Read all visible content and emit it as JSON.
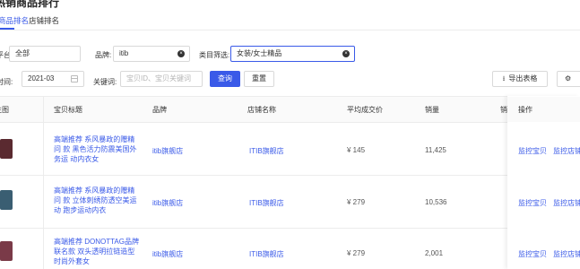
{
  "page": {
    "title": "热销商品排行"
  },
  "tabs": [
    {
      "label": "商品排名"
    },
    {
      "label": "店铺排名"
    }
  ],
  "filters": {
    "platform_label": "平台:",
    "platform_value": "全部",
    "brand_label": "品牌:",
    "brand_value": "itib",
    "category_label": "类目筛选:",
    "category_value": "女装/女士精品",
    "time_label": "时间:",
    "time_value": "2021-03",
    "keyword_label": "关键词:",
    "keyword_placeholder": "宝贝ID、宝贝关键词",
    "query_button": "查询",
    "reset_button": "重置",
    "export_button": "导出表格",
    "settings_button": "⚙"
  },
  "table": {
    "columns": [
      "主图",
      "宝贝标题",
      "品牌",
      "店铺名称",
      "平均成交价",
      "销量",
      "销",
      "操作"
    ],
    "rows": [
      {
        "title": "高端推荐 系风暴政的赠精问 款 黑色活力防震美国外务运 动内衣女",
        "brand": "itib旗舰店",
        "shop": "ITIB旗舰店",
        "avg_price": "¥ 145",
        "sales": "11,425",
        "action_1": "监控宝贝",
        "action_2": "监控店铺",
        "thumb_color": "#5a2a30"
      },
      {
        "title": "高端推荐 系风暴政的赠精问 款 立体刺绣防透空美运动 跑步运动内衣",
        "brand": "itib旗舰店",
        "shop": "ITIB旗舰店",
        "avg_price": "¥ 279",
        "sales": "10,536",
        "action_1": "监控宝贝",
        "action_2": "监控店铺",
        "thumb_color": "#3a5e72"
      },
      {
        "title": "高端推荐 DONOTTAG品牌 联名款 双头透明拉链造型 时尚外套女",
        "brand": "itib旗舰店",
        "shop": "ITIB旗舰店",
        "avg_price": "¥ 279",
        "sales": "2,001",
        "action_1": "监控宝贝",
        "action_2": "监控店铺",
        "thumb_color": "#7a3a48"
      }
    ]
  }
}
